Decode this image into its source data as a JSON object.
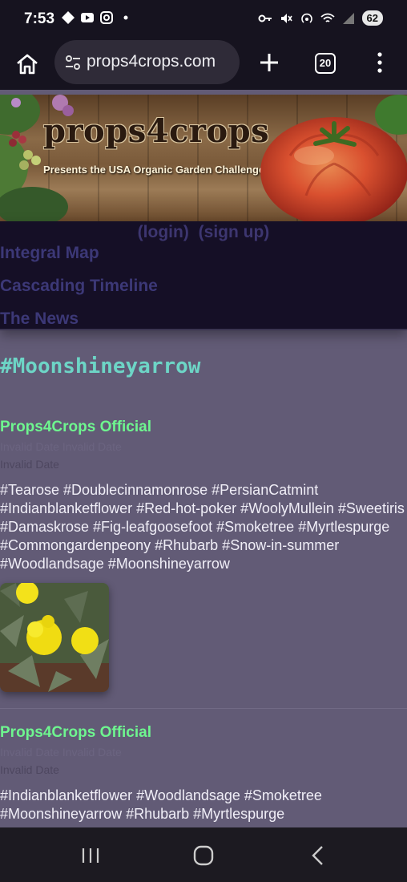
{
  "status_bar": {
    "time": "7:53",
    "battery": "62"
  },
  "browser": {
    "url": "props4crops.com",
    "tab_count": "20"
  },
  "banner": {
    "title": "props4crops",
    "subtitle": "Presents the USA Organic Garden Challenge"
  },
  "nav": {
    "login": "(login)",
    "signup": "(sign up)",
    "links": [
      "Integral Map",
      "Cascading Timeline",
      "The News"
    ]
  },
  "page": {
    "heading": "#Moonshineyarrow"
  },
  "posts": [
    {
      "author": "Props4Crops Official",
      "ghost_text": "Invalid Date Invalid Date",
      "date": "Invalid Date",
      "tags": "#Tearose #Doublecinnamonrose #PersianCatmint #Indianblanketflower #Red-hot-poker #WoolyMullein #Sweetiris #Damaskrose #Fig-leafgoosefoot #Smoketree #Myrtlespurge #Commongardenpeony #Rhubarb #Snow-in-summer #Woodlandsage #Moonshineyarrow"
    },
    {
      "author": "Props4Crops Official",
      "ghost_text": "Invalid Date Invalid Date",
      "date": "Invalid Date",
      "tags": "#Indianblanketflower #Woodlandsage #Smoketree #Moonshineyarrow #Rhubarb #Myrtlespurge"
    }
  ],
  "colors": {
    "page_bg": "#625b76",
    "author": "#6ef58f",
    "heading": "#6dd5c6",
    "nav_link": "#3c3877"
  }
}
